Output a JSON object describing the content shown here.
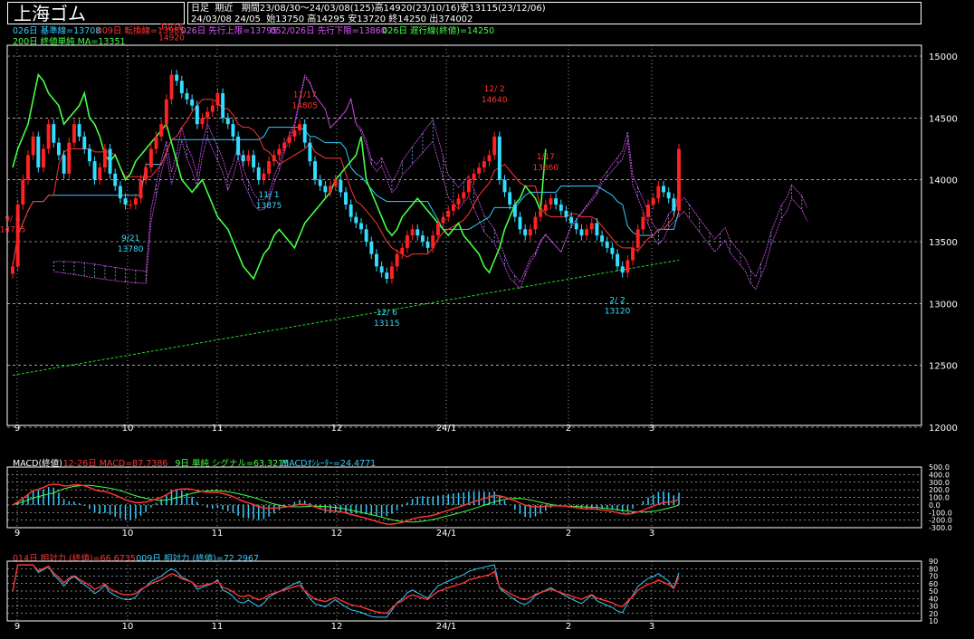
{
  "header": {
    "title": "上海ゴム",
    "info_line1": "日足  期近   期間23/08/30～24/03/08(125)高14920(23/10/16)安13115(23/12/06)",
    "info_line2": "24/03/08 24/05  始13750 高14295 安13720 終14250 出374002"
  },
  "legend": {
    "main_line1": [
      {
        "text": "026日 基準線=13708",
        "color": "#33ccff"
      },
      {
        "text": "009日 転換線=13985",
        "color": "#ff3333"
      },
      {
        "text": "026日 先行上限=13795",
        "color": "#dd55ff"
      },
      {
        "text": "052/026日 先行下限=13860",
        "color": "#dd55ff"
      },
      {
        "text": "026日 遅行線(終値)=14250",
        "color": "#44ff44"
      }
    ],
    "main_line2": [
      {
        "text": "200日 終値単純 MA=13351",
        "color": "#44ff44"
      }
    ],
    "macd": [
      {
        "text": "MACD(終値)",
        "color": "#ffffff"
      },
      {
        "text": "12-26日 MACD=87.7386",
        "color": "#ff3333"
      },
      {
        "text": "9日 単純 シグナル=63.3215",
        "color": "#44ff44"
      },
      {
        "text": "MACDｵｼﾚｰﾀｰ=24.4771",
        "color": "#33ccff"
      }
    ],
    "rs": [
      {
        "text": "014日 相対力 (終値)=66.6735",
        "color": "#ff3333"
      },
      {
        "text": "009日 相対力 (終値)=72.2967",
        "color": "#33ccff"
      }
    ]
  },
  "colors": {
    "up": "#ff2222",
    "down": "#33ddff",
    "kijun": "#33ccff",
    "tenkan": "#ff3333",
    "cloud": "#dd55ff",
    "chikou": "#44ff44",
    "ma200": "#22dd22",
    "grid": "#ffffff"
  },
  "x_labels": [
    "9",
    "10",
    "11",
    "12",
    "24/1",
    "2",
    "3"
  ],
  "chart_data": [
    {
      "type": "candlestick",
      "title": "上海ゴム",
      "ylim": [
        12000,
        15100
      ],
      "y_ticks": [
        12000,
        12500,
        13000,
        13500,
        14000,
        14500,
        15000
      ],
      "annotations": [
        {
          "date_index": 0,
          "label_date": "9/ 4",
          "label_value": "14735",
          "color": "#ff3333"
        },
        {
          "date_index": 23,
          "label_date": "9/21",
          "label_value": "13780",
          "color": "#33ddff"
        },
        {
          "date_index": 31,
          "label_date": "10/16",
          "label_value": "14920",
          "color": "#ff3333"
        },
        {
          "date_index": 57,
          "label_date": "11/17",
          "label_value": "14805",
          "color": "#ff3333"
        },
        {
          "date_index": 50,
          "label_date": "11/ 1",
          "label_value": "13875",
          "color": "#33ddff"
        },
        {
          "date_index": 73,
          "label_date": "12/ 6",
          "label_value": "13115",
          "color": "#33ddff"
        },
        {
          "date_index": 94,
          "label_date": "12/ 2",
          "label_value": "14640",
          "color": "#ff3333"
        },
        {
          "date_index": 104,
          "label_date": "1/17",
          "label_value": "13860",
          "color": "#ff3333"
        },
        {
          "date_index": 118,
          "label_date": "2/ 2",
          "label_value": "13120",
          "color": "#33ddff"
        }
      ],
      "close": [
        13300,
        13800,
        14000,
        14200,
        14350,
        14100,
        14250,
        14450,
        14300,
        14200,
        14050,
        14300,
        14450,
        14350,
        14250,
        14150,
        14000,
        14100,
        14250,
        14050,
        13950,
        13850,
        13800,
        13800,
        13850,
        14000,
        14100,
        14250,
        14350,
        14450,
        14650,
        14850,
        14800,
        14700,
        14650,
        14600,
        14450,
        14500,
        14550,
        14600,
        14700,
        14500,
        14450,
        14350,
        14200,
        14150,
        14200,
        14100,
        14000,
        14050,
        14150,
        14200,
        14250,
        14300,
        14350,
        14400,
        14450,
        14300,
        14150,
        14000,
        13950,
        13900,
        13950,
        14000,
        13900,
        13800,
        13700,
        13650,
        13600,
        13500,
        13400,
        13300,
        13250,
        13200,
        13300,
        13400,
        13450,
        13550,
        13600,
        13550,
        13500,
        13450,
        13550,
        13650,
        13700,
        13750,
        13800,
        13850,
        13900,
        14000,
        14050,
        14100,
        14150,
        14200,
        14350,
        14000,
        13900,
        13800,
        13700,
        13600,
        13550,
        13600,
        13700,
        13750,
        13800,
        13850,
        13800,
        13750,
        13700,
        13650,
        13600,
        13550,
        13600,
        13650,
        13550,
        13500,
        13450,
        13400,
        13300,
        13250,
        13350,
        13450,
        13600,
        13700,
        13800,
        13850,
        13950,
        13900,
        13850,
        13750,
        14250
      ]
    },
    {
      "type": "line",
      "title": "MACD(終値)",
      "ylim": [
        -300,
        500
      ],
      "y_ticks": [
        500,
        400,
        300,
        200,
        100,
        0,
        -100,
        -200,
        -300
      ],
      "series": [
        {
          "name": "12-26日 MACD",
          "color": "#ff3333"
        },
        {
          "name": "9日 単純 シグナル",
          "color": "#44ff44"
        },
        {
          "name": "MACDｵｼﾚｰﾀｰ",
          "color": "#33ccff"
        }
      ],
      "last_values": {
        "macd": 87.7386,
        "signal": 63.3215,
        "oscillator": 24.4771
      }
    },
    {
      "type": "line",
      "title": "相対力",
      "ylim": [
        10,
        90
      ],
      "y_ticks": [
        90,
        80,
        70,
        60,
        50,
        40,
        30,
        20,
        10
      ],
      "series": [
        {
          "name": "014日 相対力 (終値)",
          "color": "#ff3333"
        },
        {
          "name": "009日 相対力 (終値)",
          "color": "#33ccff"
        }
      ],
      "last_values": {
        "rsi14": 66.6735,
        "rsi9": 72.2967
      }
    }
  ]
}
